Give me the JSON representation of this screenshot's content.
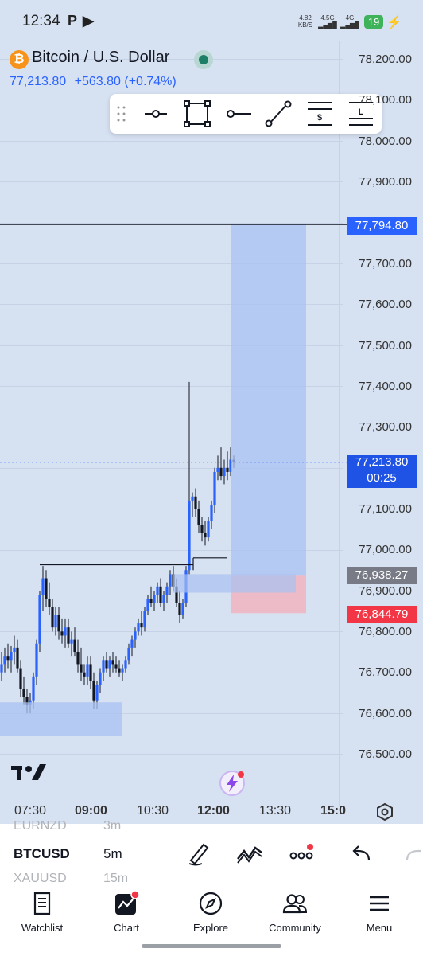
{
  "status_bar": {
    "time": "12:34",
    "net_speed": "4.82",
    "net_unit": "KB/S",
    "sim1": "4.5G",
    "sim2": "4G",
    "battery": "19"
  },
  "symbol": {
    "title": "Bitcoin / U.S. Dollar",
    "coin_glyph": "₿",
    "last_price": "77,213.80",
    "change": "+563.80 (+0.74%)",
    "change_color": "#2962ff"
  },
  "drawing_tools": [
    "horizontal-ray-icon",
    "rectangle-icon",
    "ray-icon",
    "trend-line-icon",
    "price-label-icon",
    "long-label-icon"
  ],
  "price_axis": {
    "labels": [
      "78,200.00",
      "78,100.00",
      "78,000.00",
      "77,900.00",
      "77,700.00",
      "77,600.00",
      "77,500.00",
      "77,400.00",
      "77,300.00",
      "77,100.00",
      "77,000.00",
      "76,900.00",
      "76,800.00",
      "76,700.00",
      "76,600.00",
      "76,500.00"
    ],
    "tag_target": "77,794.80",
    "tag_current": "77,213.80",
    "tag_countdown": "00:25",
    "tag_entry": "76,938.27",
    "tag_stop": "76,844.79",
    "colors": {
      "target": "#2962ff",
      "current": "#1e53e5",
      "entry": "#787b86",
      "stop": "#f23645"
    }
  },
  "time_axis": [
    "07:30",
    "09:00",
    "10:30",
    "12:00",
    "13:30",
    "15:0"
  ],
  "symbol_bar": {
    "ghost_prev_symbol": "EURNZD",
    "ghost_prev_tf": "3m",
    "symbol": "BTCUSD",
    "timeframe": "5m",
    "ghost_next_symbol": "XAUUSD",
    "ghost_next_tf": "15m"
  },
  "nav": {
    "watchlist": "Watchlist",
    "chart": "Chart",
    "explore": "Explore",
    "community": "Community",
    "menu": "Menu"
  }
}
